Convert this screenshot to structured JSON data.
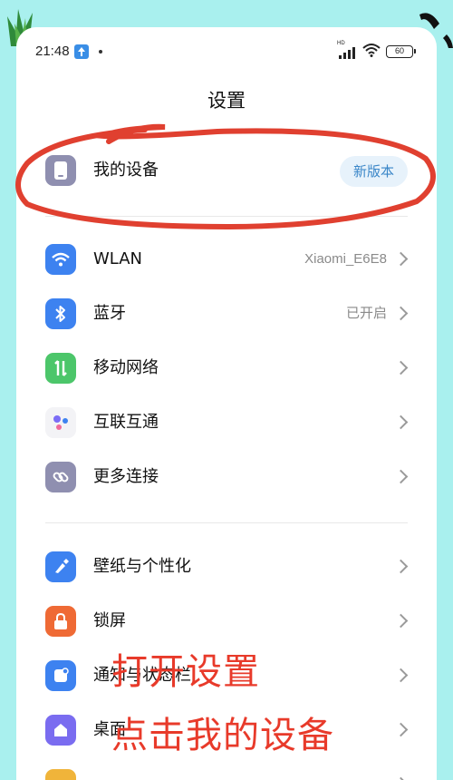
{
  "status": {
    "time": "21:48",
    "battery": "60",
    "network_label": "HD"
  },
  "page": {
    "title": "设置"
  },
  "my_device": {
    "label": "我的设备",
    "badge": "新版本"
  },
  "items_group1": [
    {
      "label": "WLAN",
      "value": "Xiaomi_E6E8",
      "icon": "wifi-icon",
      "color": "#3d82f0"
    },
    {
      "label": "蓝牙",
      "value": "已开启",
      "icon": "bluetooth-icon",
      "color": "#3d82f0"
    },
    {
      "label": "移动网络",
      "value": "",
      "icon": "mobile-network-icon",
      "color": "#4cc66a"
    },
    {
      "label": "互联互通",
      "value": "",
      "icon": "interconnect-icon",
      "color": "#f3f3f6"
    },
    {
      "label": "更多连接",
      "value": "",
      "icon": "link-icon",
      "color": "#8f8fb0"
    }
  ],
  "items_group2": [
    {
      "label": "壁纸与个性化",
      "value": "",
      "icon": "brush-icon",
      "color": "#3d82f0"
    },
    {
      "label": "锁屏",
      "value": "",
      "icon": "lock-icon",
      "color": "#ef6a35"
    },
    {
      "label": "通知与状态栏",
      "value": "",
      "icon": "notification-icon",
      "color": "#3d82f0"
    },
    {
      "label": "桌面",
      "value": "",
      "icon": "home-icon",
      "color": "#7a6cf0"
    }
  ],
  "overlay": {
    "line1": "打开设置",
    "line2": "点击我的设备"
  }
}
